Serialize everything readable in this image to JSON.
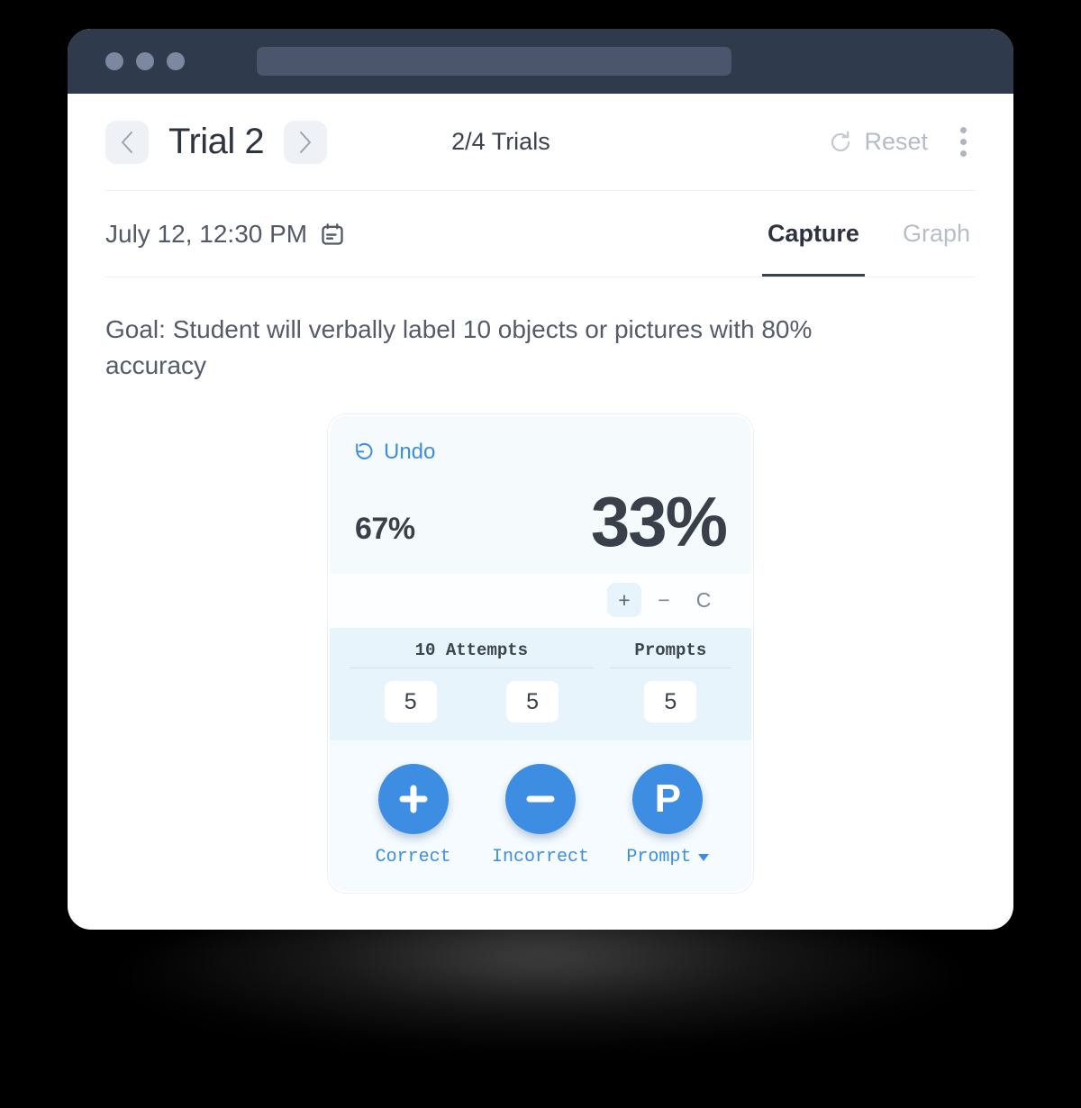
{
  "colors": {
    "titlebar": "#2f3a4d",
    "accent_blue": "#3d8ee2",
    "text_dark": "#2d3340",
    "text_muted": "#b5bcc7",
    "card_band": "#e7f4fb"
  },
  "titlebar": {
    "traffic_lights": [
      "red-dot",
      "yellow-dot",
      "green-dot"
    ],
    "address_value": "",
    "address_placeholder": ""
  },
  "header": {
    "prev_label": "‹",
    "next_label": "›",
    "trial_title": "Trial 2",
    "trial_count": "2/4 Trials",
    "reset_label": "Reset",
    "menu_label": "More options"
  },
  "meta": {
    "date_label": "July 12, 12:30 PM",
    "tabs": [
      {
        "label": "Capture",
        "active": true
      },
      {
        "label": "Graph",
        "active": false
      }
    ]
  },
  "goal": {
    "text": "Goal: Student will verbally label 10 objects or pictures with 80% accuracy"
  },
  "card": {
    "undo_label": "Undo",
    "percent_secondary": "67%",
    "percent_primary": "33%",
    "operations": [
      {
        "label": "+",
        "selected": true
      },
      {
        "label": "−",
        "selected": false
      },
      {
        "label": "C",
        "selected": false
      }
    ],
    "counters": {
      "attempts_header": "10 Attempts",
      "prompts_header": "Prompts",
      "attempts_values": [
        "5",
        "5"
      ],
      "prompts_value": "5"
    },
    "actions": [
      {
        "label": "Correct",
        "glyph": "plus",
        "has_caret": false
      },
      {
        "label": "Incorrect",
        "glyph": "minus",
        "has_caret": false
      },
      {
        "label": "Prompt",
        "glyph": "P",
        "has_caret": true
      }
    ]
  }
}
